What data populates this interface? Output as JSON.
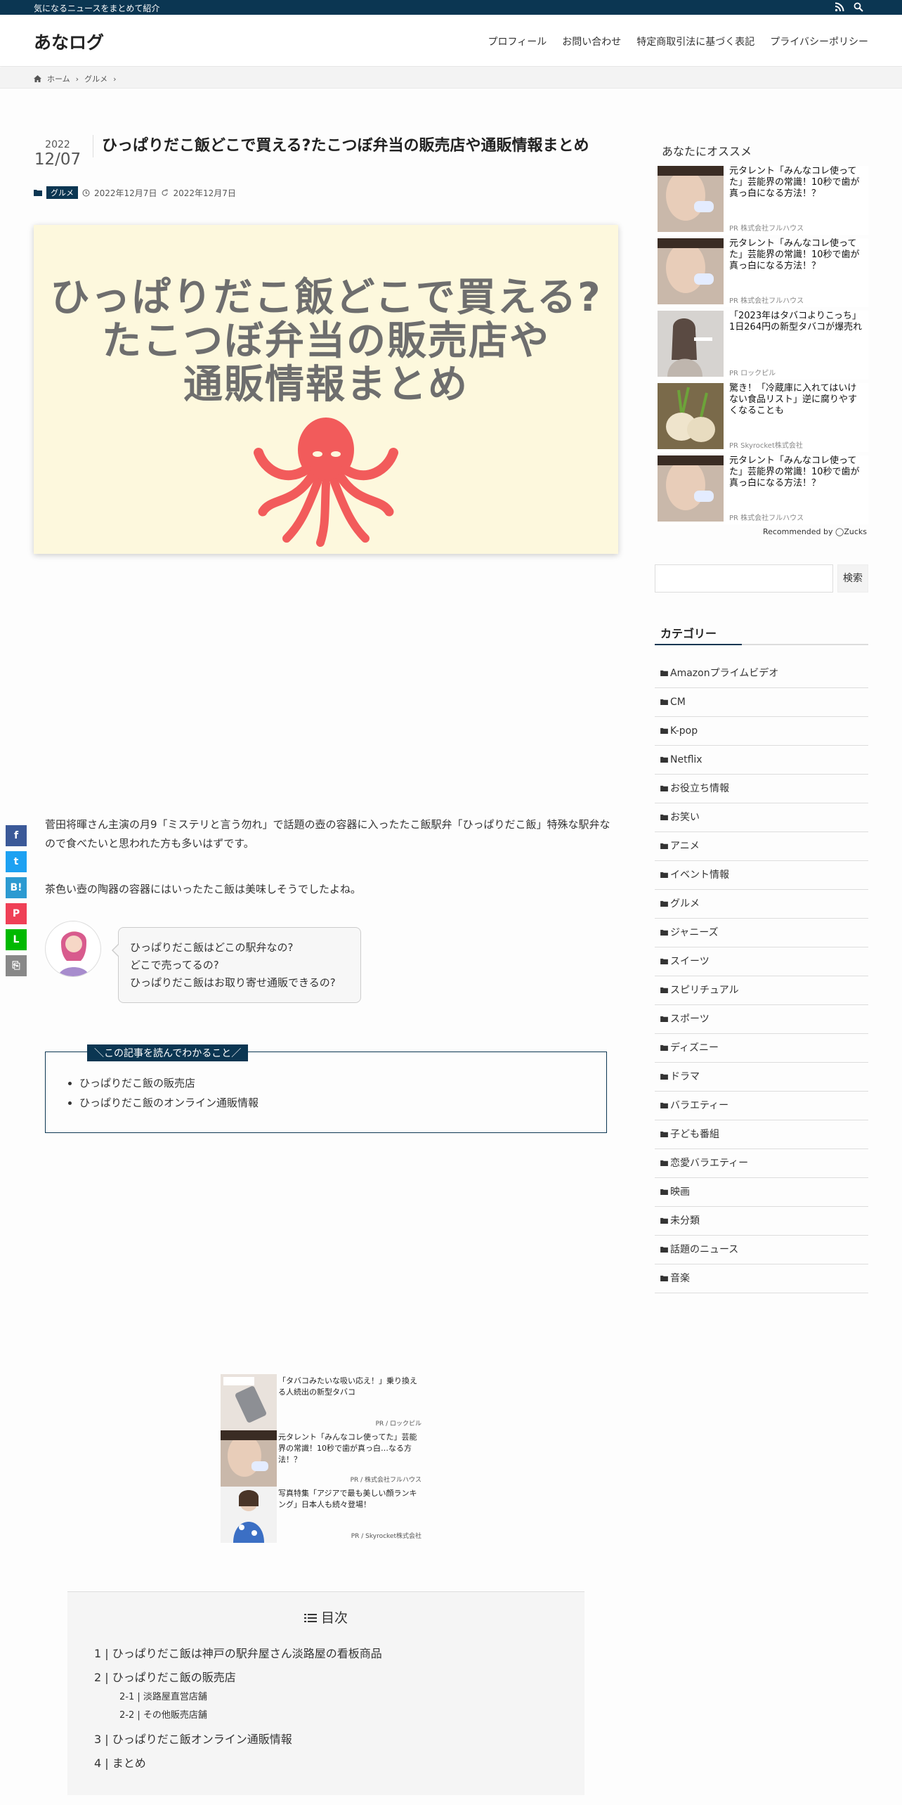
{
  "topbar": {
    "tagline": "気になるニュースをまとめて紹介"
  },
  "header": {
    "logo": "あなログ",
    "nav": [
      "プロフィール",
      "お問い合わせ",
      "特定商取引法に基づく表記",
      "プライバシーポリシー"
    ]
  },
  "breadcrumb": {
    "home": "ホーム",
    "category": "グルメ"
  },
  "article": {
    "date_year": "2022",
    "date_md": "12/07",
    "title": "ひっぱりだこ飯どこで買える?たこつぼ弁当の販売店や通販情報まとめ",
    "category": "グルメ",
    "published": "2022年12月7日",
    "updated": "2022年12月7日",
    "eyecatch_lines": [
      "ひっぱりだこ飯どこで買える?",
      "たこつぼ弁当の販売店や",
      "通販情報まとめ"
    ],
    "para1": "菅田将暉さん主演の月9「ミステリと言う勿れ」で話題の壺の容器に入ったたこ飯駅弁「ひっぱりだこ飯」特殊な駅弁なので食べたいと思われた方も多いはずです。",
    "para2": "茶色い壺の陶器の容器にはいったたこ飯は美味しそうでしたよね。",
    "bubble": [
      "ひっぱりだこ飯はどこの駅弁なの?",
      "どこで売ってるの?",
      "ひっぱりだこ飯はお取り寄せ通販できるの?"
    ],
    "point_title": "＼この記事を読んでわかること／",
    "points": [
      "ひっぱりだこ飯の販売店",
      "ひっぱりだこ飯のオンライン通販情報"
    ]
  },
  "inline_ads": [
    {
      "text": "「タバコみたいな吸い応え！」乗り換える人続出の新型タバコ",
      "pr": "PR / ロックピル"
    },
    {
      "text": "元タレント「みんなコレ使ってた」芸能界の常識！10秒で歯が真っ白…なる方法！？",
      "pr": "PR / 株式会社フルハウス"
    },
    {
      "text": "写真特集「アジアで最も美しい顔ランキング」日本人も続々登場！",
      "pr": "PR / Skyrocket株式会社"
    }
  ],
  "toc": {
    "title": "目次",
    "items": [
      "1 | ひっぱりだこ飯は神戸の駅弁屋さん淡路屋の看板商品",
      "2 | ひっぱりだこ飯の販売店",
      "3 | ひっぱりだこ飯オンライン通販情報",
      "4 | まとめ"
    ],
    "subitems": [
      "2-1 | 淡路屋直営店舗",
      "2-2 | その他販売店舗"
    ]
  },
  "sidebar": {
    "rec_title": "あなたにオススメ",
    "recs": [
      {
        "text": "元タレント「みんなコレ使ってた」芸能界の常識！10秒で歯が真っ白になる方法！？",
        "pr": "PR 株式会社フルハウス"
      },
      {
        "text": "元タレント「みんなコレ使ってた」芸能界の常識！10秒で歯が真っ白になる方法！？",
        "pr": "PR 株式会社フルハウス"
      },
      {
        "text": "「2023年はタバコよりこっち」1日264円の新型タバコが爆売れ",
        "pr": "PR ロックピル"
      },
      {
        "text": "驚き！「冷蔵庫に入れてはいけない食品リスト」逆に腐りやすくなることも",
        "pr": "PR Skyrocket株式会社"
      },
      {
        "text": "元タレント「みんなコレ使ってた」芸能界の常識！10秒で歯が真っ白になる方法！？",
        "pr": "PR 株式会社フルハウス"
      }
    ],
    "recommended_by": "Recommended by ◯Zucks",
    "search_button": "検索",
    "category_head": "カテゴリー",
    "categories": [
      "Amazonプライムビデオ",
      "CM",
      "K-pop",
      "Netflix",
      "お役立ち情報",
      "お笑い",
      "アニメ",
      "イベント情報",
      "グルメ",
      "ジャニーズ",
      "スイーツ",
      "スピリチュアル",
      "スポーツ",
      "ディズニー",
      "ドラマ",
      "バラエティー",
      "子ども番組",
      "恋愛バラエティー",
      "映画",
      "未分類",
      "話題のニュース",
      "音楽"
    ]
  },
  "share": {
    "labels": [
      "f",
      "t",
      "B!",
      "P",
      "L",
      "⎘"
    ],
    "colors": [
      "#3b5998",
      "#1da1f2",
      "#2c9ad1",
      "#ef4056",
      "#00b900",
      "#888888"
    ]
  },
  "colors": {
    "navy": "#0b3652",
    "eyecatch_bg": "#fdf8dd",
    "octopus": "#f25b5b"
  }
}
